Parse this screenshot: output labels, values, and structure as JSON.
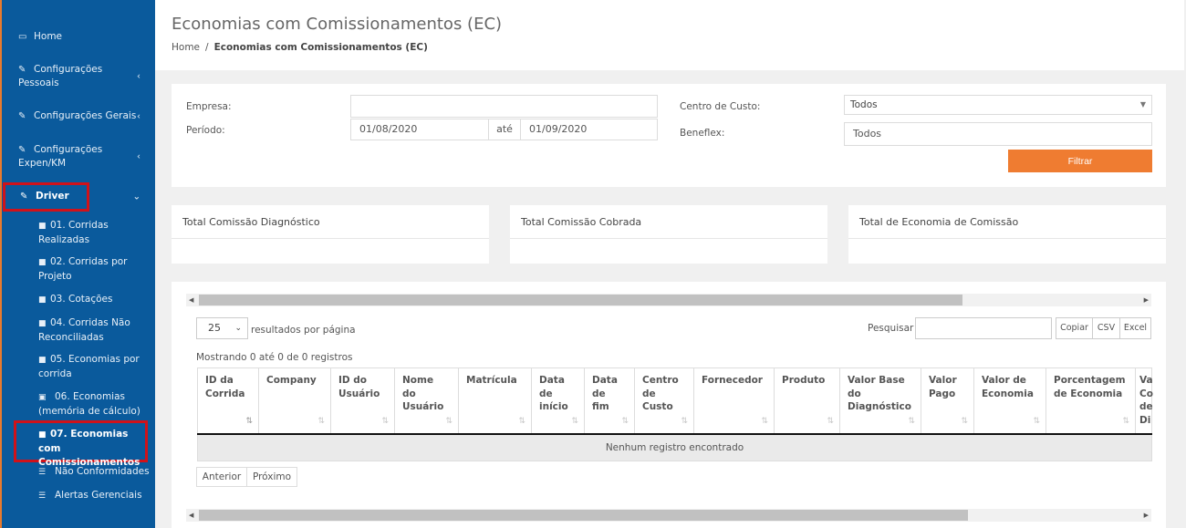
{
  "sidebar": {
    "home": "Home",
    "config_pessoais": [
      "Configurações",
      "Pessoais"
    ],
    "config_gerais": "Configurações Gerais",
    "config_expen": [
      "Configurações",
      "Expen/KM"
    ],
    "driver": "Driver",
    "sub": [
      [
        "01. Corridas",
        "Realizadas"
      ],
      [
        "02. Corridas por",
        "Projeto"
      ],
      [
        "03. Cotações"
      ],
      [
        "04. Corridas Não",
        "Reconciliadas"
      ],
      [
        "05. Economias por",
        "corrida"
      ],
      [
        "06. Economias",
        "(memória de cálculo)"
      ],
      [
        "07. Economias com",
        "Comissionamentos"
      ],
      [
        "Não Conformidades"
      ],
      [
        "Alertas Gerenciais"
      ]
    ]
  },
  "header": {
    "title": "Economias com Comissionamentos (EC)",
    "breadcrumb_home": "Home",
    "breadcrumb_sep": "/",
    "breadcrumb_current": "Economias com Comissionamentos (EC)"
  },
  "filters": {
    "empresa_label": "Empresa:",
    "empresa_value": "",
    "periodo_label": "Período:",
    "date_from": "01/08/2020",
    "ate": "até",
    "date_to": "01/09/2020",
    "centro_label": "Centro de Custo:",
    "centro_value": "Todos",
    "beneflex_label": "Beneflex:",
    "beneflex_value": "Todos",
    "filter_button": "Filtrar"
  },
  "totals": {
    "diagnostico": "Total Comissão Diagnóstico",
    "cobrada": "Total Comissão Cobrada",
    "economia": "Total de Economia de Comissão"
  },
  "table": {
    "page_length": "25",
    "length_suffix": "resultados por página",
    "search_label": "Pesquisar",
    "search_value": "",
    "export": [
      "Copiar",
      "CSV",
      "Excel"
    ],
    "info": "Mostrando 0 até 0 de 0 registros",
    "columns": [
      [
        "ID da",
        "Corrida"
      ],
      [
        "Company"
      ],
      [
        "ID do",
        "Usuário"
      ],
      [
        "Nome",
        "do",
        "Usuário"
      ],
      [
        "Matrícula"
      ],
      [
        "Data",
        "de",
        "início"
      ],
      [
        "Data",
        "de",
        "fim"
      ],
      [
        "Centro",
        "de",
        "Custo"
      ],
      [
        "Fornecedor"
      ],
      [
        "Produto"
      ],
      [
        "Valor Base",
        "do",
        "Diagnóstico"
      ],
      [
        "Valor",
        "Pago"
      ],
      [
        "Valor de",
        "Economia"
      ],
      [
        "Porcentagem",
        "de Economia"
      ],
      [
        "Va",
        "Co",
        "de",
        "Di"
      ]
    ],
    "empty_message": "Nenhum registro encontrado",
    "prev": "Anterior",
    "next": "Próximo"
  },
  "icons": {
    "home": "monitor-icon",
    "edit": "edit-icon",
    "doc": "document-icon",
    "list": "list-icon",
    "image": "image-icon",
    "sort": "sort-icon"
  },
  "colors": {
    "sidebar_bg": "#0a5a9c",
    "accent": "#ef7c31",
    "highlight": "#d0121a"
  }
}
